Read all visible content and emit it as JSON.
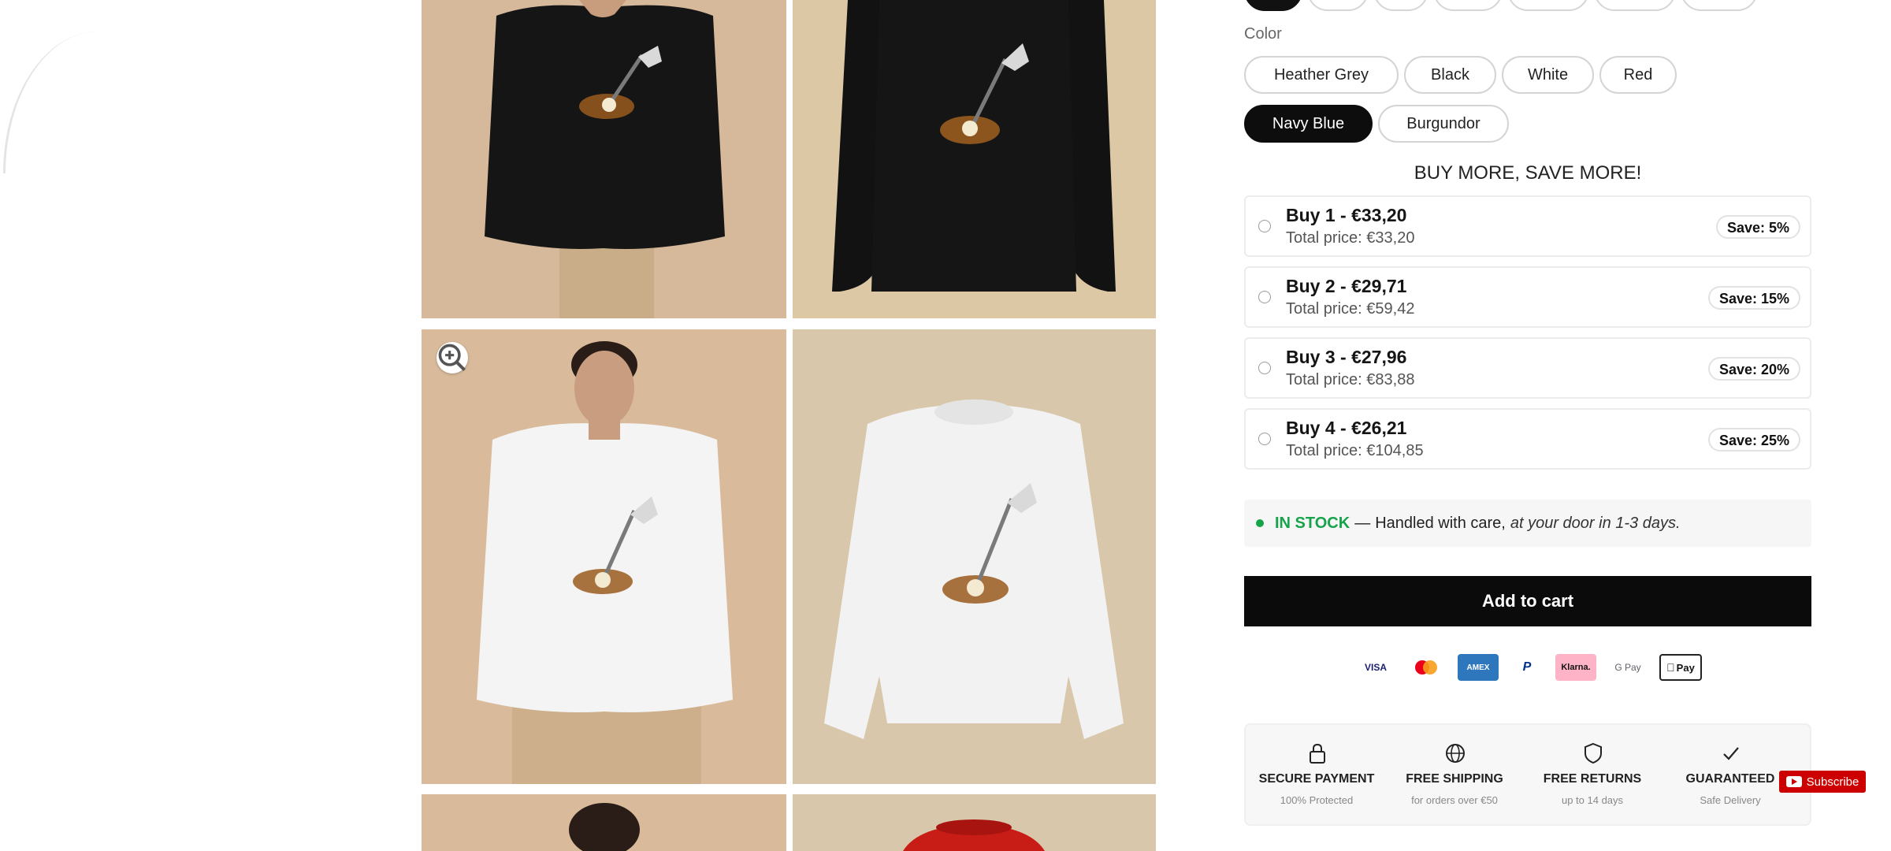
{
  "colors": {
    "accent": "#0d0d0d",
    "in_stock": "#16a34a",
    "youtube_red": "#cc0000"
  },
  "gallery": {
    "zoom_icon": "magnifier-plus-icon",
    "images": [
      {
        "name": "model-black-sweatshirt"
      },
      {
        "name": "black-sweatshirt-flatlay"
      },
      {
        "name": "model-white-sweatshirt"
      },
      {
        "name": "white-sweatshirt-flatlay"
      },
      {
        "name": "model-partial"
      },
      {
        "name": "red-sweatshirt-partial"
      }
    ]
  },
  "color_picker": {
    "label": "Color",
    "options": [
      "Heather Grey",
      "Black",
      "White",
      "Red",
      "Navy Blue",
      "Burgundor"
    ],
    "selected": "Navy Blue"
  },
  "promo": {
    "heading": "BUY MORE, SAVE MORE!"
  },
  "bundles": [
    {
      "title": "Buy 1 - €33,20",
      "total": "Total price: €33,20",
      "save": "Save: 5%"
    },
    {
      "title": "Buy 2 - €29,71",
      "total": "Total price: €59,42",
      "save": "Save: 15%"
    },
    {
      "title": "Buy 3 - €27,96",
      "total": "Total price: €83,88",
      "save": "Save: 20%"
    },
    {
      "title": "Buy 4 - €26,21",
      "total": "Total price: €104,85",
      "save": "Save: 25%"
    }
  ],
  "stock": {
    "status": "IN STOCK",
    "dash": "—",
    "text": "Handled with care,",
    "delivery": "at your door in 1-3 days."
  },
  "cart": {
    "label": "Add to cart"
  },
  "payments": [
    {
      "name": "visa-icon",
      "label": "VISA"
    },
    {
      "name": "mastercard-icon",
      "label": ""
    },
    {
      "name": "amex-icon",
      "label": "AMEX"
    },
    {
      "name": "paypal-icon",
      "label": "P"
    },
    {
      "name": "klarna-icon",
      "label": "Klarna."
    },
    {
      "name": "google-pay-icon",
      "label": "G Pay"
    },
    {
      "name": "apple-pay-icon",
      "label": "Pay"
    }
  ],
  "trust": [
    {
      "icon": "lock-icon",
      "title": "SECURE PAYMENT",
      "subtitle": "100% Protected"
    },
    {
      "icon": "globe-icon",
      "title": "FREE SHIPPING",
      "subtitle": "for orders over €50"
    },
    {
      "icon": "shield-icon",
      "title": "FREE RETURNS",
      "subtitle": "up to 14 days"
    },
    {
      "icon": "checkmark-icon",
      "title": "GUARANTEED",
      "subtitle": "Safe Delivery"
    }
  ],
  "subscribe": {
    "label": "Subscribe"
  }
}
